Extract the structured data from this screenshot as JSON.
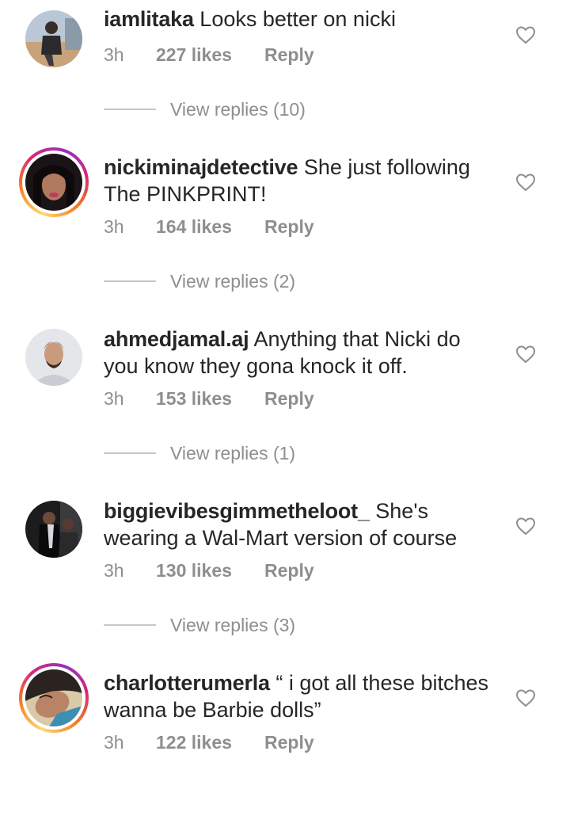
{
  "comments": [
    {
      "username": "iamlitaka",
      "text": "Looks better on nicki",
      "time": "3h",
      "likes": "227 likes",
      "reply": "Reply",
      "view_replies": "View replies (10)",
      "has_story_ring": false
    },
    {
      "username": "nickiminajdetective",
      "text": "She just following The PINKPRINT!",
      "time": "3h",
      "likes": "164 likes",
      "reply": "Reply",
      "view_replies": "View replies (2)",
      "has_story_ring": true
    },
    {
      "username": "ahmedjamal.aj",
      "text": "Anything that Nicki do you know they gona knock it off.",
      "time": "3h",
      "likes": "153 likes",
      "reply": "Reply",
      "view_replies": "View replies (1)",
      "has_story_ring": false
    },
    {
      "username": "biggievibesgimmetheloot_",
      "text": "She's wearing a Wal-Mart version of course",
      "time": "3h",
      "likes": "130 likes",
      "reply": "Reply",
      "view_replies": "View replies (3)",
      "has_story_ring": false
    },
    {
      "username": "charlotterumerla",
      "text": "“ i got all these bitches wanna be Barbie dolls”",
      "time": "3h",
      "likes": "122 likes",
      "reply": "Reply",
      "has_story_ring": true
    }
  ],
  "icons": {
    "like": "heart-outline-icon"
  },
  "colors": {
    "text": "#262626",
    "secondary": "#8e8e8e",
    "divider": "#c7c7c7",
    "story_ring": "#d62976"
  }
}
